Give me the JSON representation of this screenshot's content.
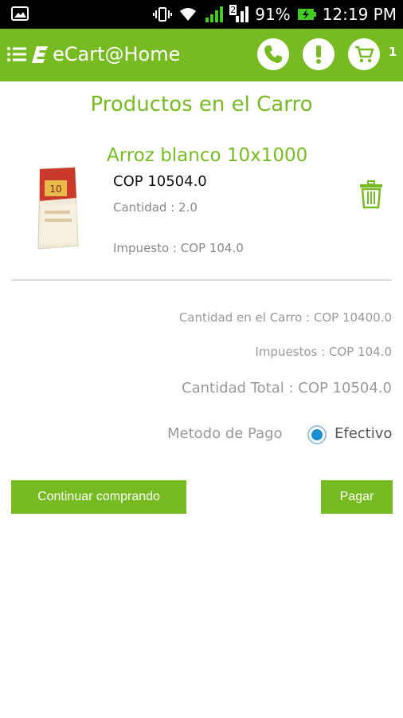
{
  "status_bar": {
    "battery": "91%",
    "time": "12:19 PM",
    "sim_slot": "2"
  },
  "app_bar": {
    "title": "eCart@Home",
    "cart_count": "1",
    "accent_color": "#77bb22",
    "icons": [
      "menu-icon",
      "ecart-logo-icon",
      "phone-icon",
      "alert-icon",
      "cart-icon"
    ]
  },
  "page": {
    "title": "Productos en el Carro"
  },
  "cart_items": [
    {
      "name": "Arroz blanco 10x1000",
      "price": "COP 10504.0",
      "quantity": "Cantidad : 2.0",
      "tax": "Impuesto : COP 104.0"
    }
  ],
  "summary": {
    "cart_amount": "Cantidad en el Carro : COP 10400.0",
    "taxes": "Impuestos : COP 104.0",
    "total": "Cantidad Total : COP 10504.0"
  },
  "payment": {
    "label": "Metodo de Pago",
    "option": "Efectivo",
    "selected": true
  },
  "buttons": {
    "continue": "Continuar comprando",
    "pay": "Pagar"
  }
}
